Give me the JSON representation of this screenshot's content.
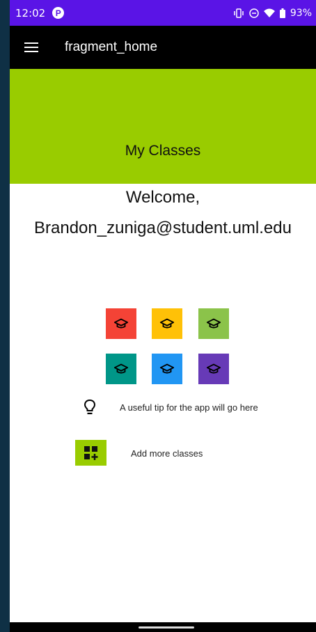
{
  "status_bar": {
    "time": "12:02",
    "app_icon_glyph": "P",
    "battery": "93%",
    "color": "#5a14e6"
  },
  "app_bar": {
    "title": "fragment_home"
  },
  "banner": {
    "title": "My Classes",
    "color": "#99cc00"
  },
  "welcome": {
    "greeting": "Welcome,",
    "email": "Brandon_zuniga@student.uml.edu"
  },
  "classes": [
    {
      "color": "#f44336",
      "icon": "graduation-cap-icon"
    },
    {
      "color": "#ffc107",
      "icon": "graduation-cap-icon"
    },
    {
      "color": "#8bc34a",
      "icon": "graduation-cap-icon"
    },
    {
      "color": "#009688",
      "icon": "graduation-cap-icon"
    },
    {
      "color": "#2196f3",
      "icon": "graduation-cap-icon"
    },
    {
      "color": "#673ab7",
      "icon": "graduation-cap-icon"
    }
  ],
  "tip": {
    "text": "A useful tip for the app will go here",
    "icon": "lightbulb-icon"
  },
  "add_classes": {
    "label": "Add more classes",
    "icon": "add-grid-icon"
  }
}
